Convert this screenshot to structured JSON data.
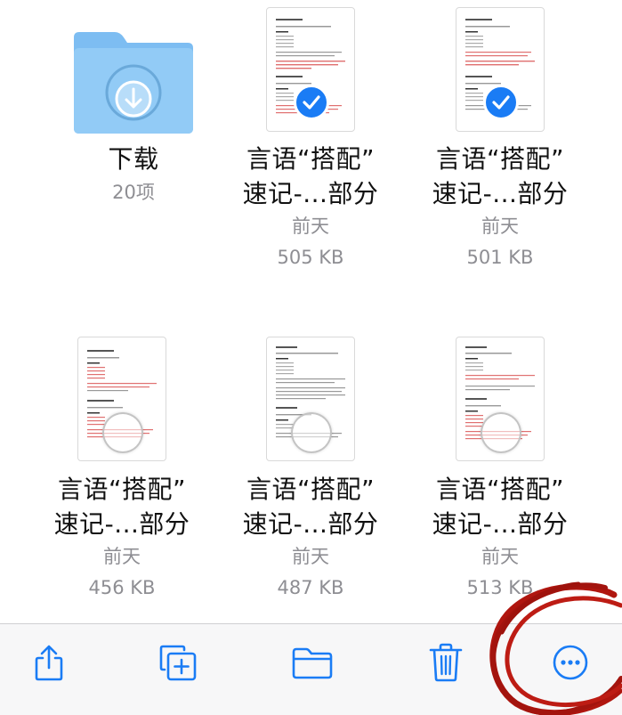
{
  "files": [
    {
      "title": "下载",
      "subtitle1": "20项",
      "subtitle2": "",
      "kind": "folder",
      "selected": false
    },
    {
      "title_line1": "言语“搭配”",
      "title_line2": "速记-...部分",
      "date": "前天",
      "size": "505 KB",
      "kind": "document",
      "selected": true
    },
    {
      "title_line1": "言语“搭配”",
      "title_line2": "速记-...部分",
      "date": "前天",
      "size": "501 KB",
      "kind": "document",
      "selected": true
    },
    {
      "title_line1": "言语“搭配”",
      "title_line2": "速记-...部分",
      "date": "前天",
      "size": "456 KB",
      "kind": "document",
      "selected": false
    },
    {
      "title_line1": "言语“搭配”",
      "title_line2": "速记-...部分",
      "date": "前天",
      "size": "487 KB",
      "kind": "document",
      "selected": false
    },
    {
      "title_line1": "言语“搭配”",
      "title_line2": "速记-...部分",
      "date": "前天",
      "size": "513 KB",
      "kind": "document",
      "selected": false
    }
  ],
  "toolbar": {
    "buttons": [
      {
        "icon": "share-icon"
      },
      {
        "icon": "duplicate-icon"
      },
      {
        "icon": "move-folder-icon"
      },
      {
        "icon": "trash-icon"
      },
      {
        "icon": "more-ellipsis-icon"
      }
    ]
  },
  "colors": {
    "accent": "#1a7cf5",
    "folder": "#8cc6f5",
    "secondary_text": "#8e8e93",
    "annotation": "#b0160f"
  }
}
